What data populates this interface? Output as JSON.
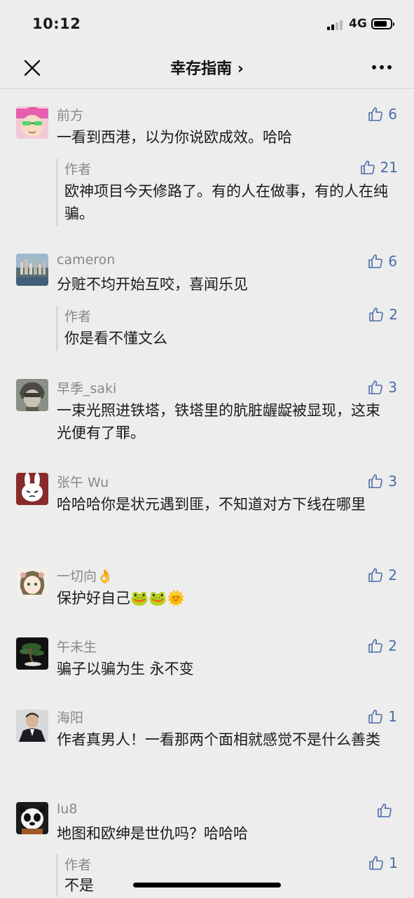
{
  "status_bar": {
    "time": "10:12",
    "network": "4G"
  },
  "nav": {
    "title": "幸存指南 ›",
    "close_icon": "close-icon",
    "more_icon": "more-icon"
  },
  "comments": [
    {
      "name": "前方",
      "text": "一看到西港，以为你说欧成效。哈哈",
      "likes": "6",
      "reply": {
        "name": "作者",
        "text": "欧神项目今天修路了。有的人在做事，有的人在纯骗。",
        "likes": "21"
      }
    },
    {
      "name": "cameron",
      "text": "分赃不均开始互咬，喜闻乐见",
      "likes": "6",
      "reply": {
        "name": "作者",
        "text": "你是看不懂文么",
        "likes": "2"
      }
    },
    {
      "name": "早季_saki",
      "text": "一束光照进铁塔，铁塔里的肮脏龌龊被显现，这束光便有了罪。",
      "likes": "3"
    },
    {
      "name": "张午 Wu",
      "text": "哈哈哈你是状元遇到匪，不知道对方下线在哪里",
      "likes": "3"
    },
    {
      "name": "一切向👌",
      "text": "保护好自己🐸🐸🌞",
      "likes": "2"
    },
    {
      "name": "午未生",
      "text": "骗子以骗为生 永不变",
      "likes": "2"
    },
    {
      "name": "海阳",
      "text": "作者真男人！一看那两个面相就感觉不是什么善类",
      "likes": "1"
    },
    {
      "name": "lu8",
      "text": "地图和欧绅是世仇吗？哈哈哈",
      "likes": "",
      "reply": {
        "name": "作者",
        "text": "不是",
        "likes": "1"
      }
    }
  ],
  "colors": {
    "background": "#ededed",
    "link_blue": "#4a6da7",
    "muted_gray": "#888888"
  }
}
